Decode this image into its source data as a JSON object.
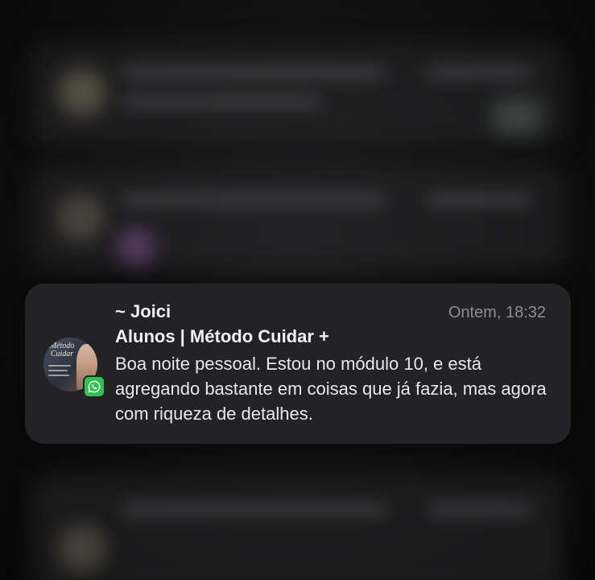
{
  "notification": {
    "sender": "~ Joici",
    "timestamp": "Ontem, 18:32",
    "group": "Alunos | Método Cuidar +",
    "message": "Boa noite pessoal. Estou no módulo 10, e está agregando bastante em coisas que já fazia, mas agora com riqueza de detalhes.",
    "avatar_text": "Método Cuidar",
    "app_icon": "whatsapp-icon"
  },
  "colors": {
    "card_background": "#232325",
    "whatsapp_green": "#2fc24e",
    "timestamp_gray": "#8e8e93"
  }
}
